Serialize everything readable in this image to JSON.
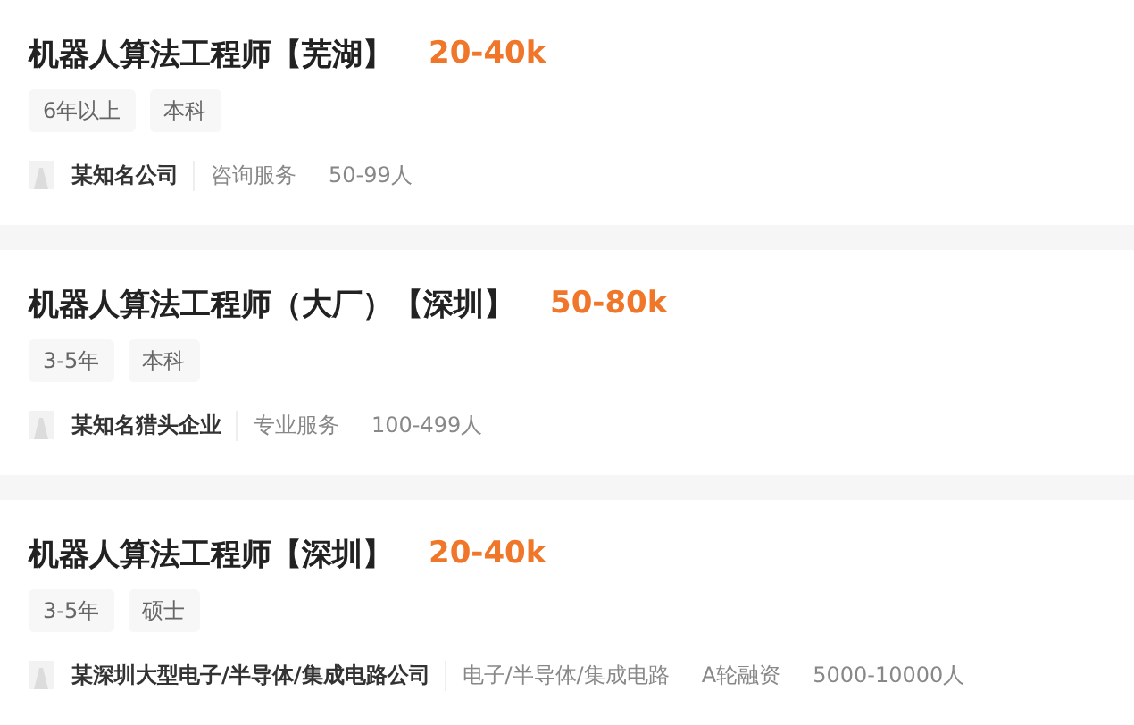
{
  "jobs": [
    {
      "title": "机器人算法工程师【芜湖】",
      "salary": "20-40k",
      "tags": [
        "6年以上",
        "本科"
      ],
      "company": "某知名公司",
      "company_info": [
        "咨询服务",
        "50-99人"
      ]
    },
    {
      "title": "机器人算法工程师（大厂）【深圳】",
      "salary": "50-80k",
      "tags": [
        "3-5年",
        "本科"
      ],
      "company": "某知名猎头企业",
      "company_info": [
        "专业服务",
        "100-499人"
      ]
    },
    {
      "title": "机器人算法工程师【深圳】",
      "salary": "20-40k",
      "tags": [
        "3-5年",
        "硕士"
      ],
      "company": "某深圳大型电子/半导体/集成电路公司",
      "company_info": [
        "电子/半导体/集成电路",
        "A轮融资",
        "5000-10000人"
      ]
    }
  ]
}
